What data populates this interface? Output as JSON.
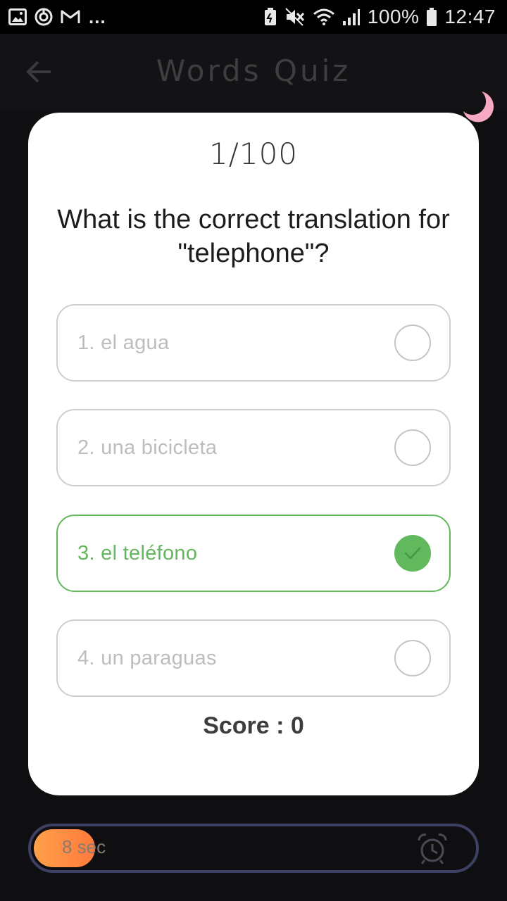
{
  "status_bar": {
    "left_icons": [
      "image-icon",
      "sync-icon",
      "gmail-icon"
    ],
    "overflow": "...",
    "right_icons": [
      "battery-saver-icon",
      "mute-icon",
      "wifi-icon",
      "signal-icon"
    ],
    "battery": "100%",
    "time": "12:47"
  },
  "app_bar": {
    "title": "Words Quiz",
    "back_icon": "back-arrow-icon",
    "theme_icon": "moon-icon"
  },
  "quiz": {
    "progress": "1/100",
    "question": "What is the correct translation for \"telephone\"?",
    "options": [
      {
        "label": "1. el agua",
        "state": "unselected"
      },
      {
        "label": "2. una bicicleta",
        "state": "unselected"
      },
      {
        "label": "3. el teléfono",
        "state": "correct"
      },
      {
        "label": "4. un paraguas",
        "state": "unselected"
      }
    ],
    "score": "Score : 0"
  },
  "timer": {
    "text": "8 sec",
    "remaining_fraction": 0.14,
    "icon": "alarm-clock-icon"
  },
  "colors": {
    "correct": "#62b85c",
    "timer_fill": "#ff8c42",
    "timer_border": "#3d3f63",
    "moon": "#f7a9c2",
    "background": "#0f0f11"
  }
}
